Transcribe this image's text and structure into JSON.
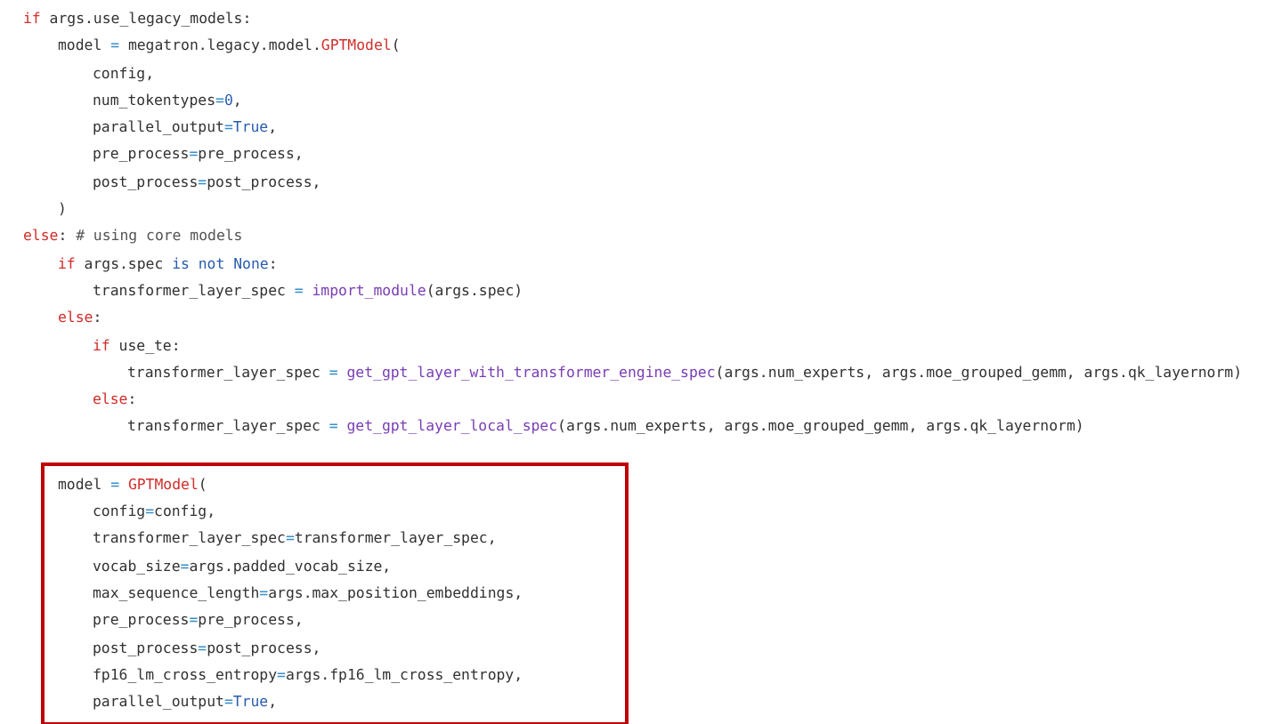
{
  "code": [
    {
      "kind": "line",
      "tokens": [
        {
          "kind": "kw",
          "text": "if"
        },
        {
          "kind": "plain",
          "text": " args.use_legacy_models:"
        }
      ],
      "children": [
        {
          "kind": "line",
          "tokens": [
            {
              "kind": "plain",
              "text": "model "
            },
            {
              "kind": "op",
              "text": "="
            },
            {
              "kind": "plain",
              "text": " megatron.legacy.model."
            },
            {
              "kind": "cls",
              "text": "GPTModel"
            },
            {
              "kind": "plain",
              "text": "("
            }
          ],
          "children": [
            {
              "kind": "line",
              "tokens": [
                {
                  "kind": "plain",
                  "text": "config,"
                }
              ]
            },
            {
              "kind": "line",
              "tokens": [
                {
                  "kind": "plain",
                  "text": "num_tokentypes"
                },
                {
                  "kind": "op",
                  "text": "="
                },
                {
                  "kind": "const",
                  "text": "0"
                },
                {
                  "kind": "plain",
                  "text": ","
                }
              ]
            },
            {
              "kind": "line",
              "tokens": [
                {
                  "kind": "plain",
                  "text": "parallel_output"
                },
                {
                  "kind": "op",
                  "text": "="
                },
                {
                  "kind": "const",
                  "text": "True"
                },
                {
                  "kind": "plain",
                  "text": ","
                }
              ]
            },
            {
              "kind": "line",
              "tokens": [
                {
                  "kind": "plain",
                  "text": "pre_process"
                },
                {
                  "kind": "op",
                  "text": "="
                },
                {
                  "kind": "plain",
                  "text": "pre_process,"
                }
              ]
            },
            {
              "kind": "line",
              "tokens": [
                {
                  "kind": "plain",
                  "text": "post_process"
                },
                {
                  "kind": "op",
                  "text": "="
                },
                {
                  "kind": "plain",
                  "text": "post_process,"
                }
              ]
            }
          ]
        },
        {
          "kind": "line",
          "tokens": [
            {
              "kind": "plain",
              "text": ")"
            }
          ]
        }
      ]
    },
    {
      "kind": "line",
      "tokens": [
        {
          "kind": "kw",
          "text": "else"
        },
        {
          "kind": "plain",
          "text": ": "
        },
        {
          "kind": "comment",
          "text": "# using core models"
        }
      ],
      "children": [
        {
          "kind": "line",
          "tokens": [
            {
              "kind": "kw",
              "text": "if"
            },
            {
              "kind": "plain",
              "text": " args.spec "
            },
            {
              "kind": "const",
              "text": "is not None"
            },
            {
              "kind": "plain",
              "text": ":"
            }
          ],
          "children": [
            {
              "kind": "line",
              "tokens": [
                {
                  "kind": "plain",
                  "text": "transformer_layer_spec "
                },
                {
                  "kind": "op",
                  "text": "= "
                },
                {
                  "kind": "func",
                  "text": "import_module"
                },
                {
                  "kind": "plain",
                  "text": "(args.spec)"
                }
              ]
            }
          ]
        },
        {
          "kind": "line",
          "tokens": [
            {
              "kind": "kw",
              "text": "else"
            },
            {
              "kind": "plain",
              "text": ":"
            }
          ],
          "children": [
            {
              "kind": "line",
              "tokens": [
                {
                  "kind": "kw",
                  "text": "if"
                },
                {
                  "kind": "plain",
                  "text": " use_te:"
                }
              ],
              "children": [
                {
                  "kind": "line",
                  "tokens": [
                    {
                      "kind": "plain",
                      "text": "transformer_layer_spec "
                    },
                    {
                      "kind": "op",
                      "text": "= "
                    },
                    {
                      "kind": "func",
                      "text": "get_gpt_layer_with_transformer_engine_spec"
                    },
                    {
                      "kind": "plain",
                      "text": "(args.num_experts, args.moe_grouped_gemm, args.qk_layernorm)"
                    }
                  ]
                }
              ]
            },
            {
              "kind": "line",
              "tokens": [
                {
                  "kind": "kw",
                  "text": "else"
                },
                {
                  "kind": "plain",
                  "text": ":"
                }
              ],
              "children": [
                {
                  "kind": "line",
                  "tokens": [
                    {
                      "kind": "plain",
                      "text": "transformer_layer_spec "
                    },
                    {
                      "kind": "op",
                      "text": "= "
                    },
                    {
                      "kind": "func",
                      "text": "get_gpt_layer_local_spec"
                    },
                    {
                      "kind": "plain",
                      "text": "(args.num_experts, args.moe_grouped_gemm, args.qk_layernorm)"
                    }
                  ]
                }
              ]
            }
          ]
        },
        {
          "kind": "highlight",
          "children": [
            {
              "kind": "line",
              "tokens": [
                {
                  "kind": "plain",
                  "text": "model "
                },
                {
                  "kind": "op",
                  "text": "= "
                },
                {
                  "kind": "cls",
                  "text": "GPTModel"
                },
                {
                  "kind": "plain",
                  "text": "("
                }
              ],
              "children": [
                {
                  "kind": "line",
                  "tokens": [
                    {
                      "kind": "plain",
                      "text": "config"
                    },
                    {
                      "kind": "op",
                      "text": "="
                    },
                    {
                      "kind": "plain",
                      "text": "config,"
                    }
                  ]
                },
                {
                  "kind": "line",
                  "tokens": [
                    {
                      "kind": "plain",
                      "text": "transformer_layer_spec"
                    },
                    {
                      "kind": "op",
                      "text": "="
                    },
                    {
                      "kind": "plain",
                      "text": "transformer_layer_spec,"
                    }
                  ]
                },
                {
                  "kind": "line",
                  "tokens": [
                    {
                      "kind": "plain",
                      "text": "vocab_size"
                    },
                    {
                      "kind": "op",
                      "text": "="
                    },
                    {
                      "kind": "plain",
                      "text": "args.padded_vocab_size,"
                    }
                  ]
                },
                {
                  "kind": "line",
                  "tokens": [
                    {
                      "kind": "plain",
                      "text": "max_sequence_length"
                    },
                    {
                      "kind": "op",
                      "text": "="
                    },
                    {
                      "kind": "plain",
                      "text": "args.max_position_embeddings,"
                    }
                  ]
                },
                {
                  "kind": "line",
                  "tokens": [
                    {
                      "kind": "plain",
                      "text": "pre_process"
                    },
                    {
                      "kind": "op",
                      "text": "="
                    },
                    {
                      "kind": "plain",
                      "text": "pre_process,"
                    }
                  ]
                },
                {
                  "kind": "line",
                  "tokens": [
                    {
                      "kind": "plain",
                      "text": "post_process"
                    },
                    {
                      "kind": "op",
                      "text": "="
                    },
                    {
                      "kind": "plain",
                      "text": "post_process,"
                    }
                  ]
                },
                {
                  "kind": "line",
                  "tokens": [
                    {
                      "kind": "plain",
                      "text": "fp16_lm_cross_entropy"
                    },
                    {
                      "kind": "op",
                      "text": "="
                    },
                    {
                      "kind": "plain",
                      "text": "args.fp16_lm_cross_entropy,"
                    }
                  ]
                },
                {
                  "kind": "line",
                  "tokens": [
                    {
                      "kind": "plain",
                      "text": "parallel_output"
                    },
                    {
                      "kind": "op",
                      "text": "="
                    },
                    {
                      "kind": "const",
                      "text": "True"
                    },
                    {
                      "kind": "plain",
                      "text": ","
                    }
                  ]
                }
              ]
            }
          ]
        }
      ]
    }
  ]
}
